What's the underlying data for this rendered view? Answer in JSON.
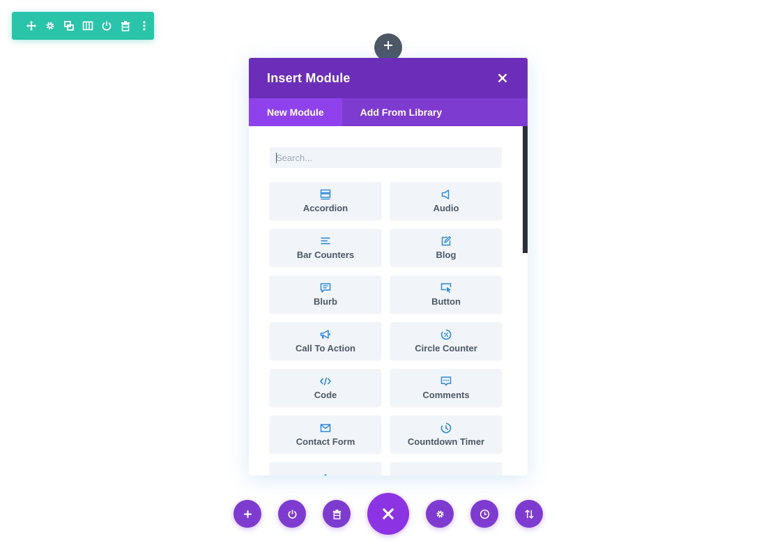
{
  "colors": {
    "row_toolbar": "#29c4a9",
    "modal_header": "#6c2eb9",
    "modal_tabs": "#7e3bd0",
    "modal_tab_active": "#8f42ec",
    "icon_blue": "#2b87da",
    "text": "#4c5866"
  },
  "row_toolbar": {
    "icons": [
      "move-icon",
      "settings-icon",
      "duplicate-icon",
      "columns-icon",
      "power-icon",
      "trash-icon",
      "more-icon"
    ]
  },
  "modal": {
    "title": "Insert Module",
    "tabs": [
      {
        "label": "New Module",
        "active": true
      },
      {
        "label": "Add From Library",
        "active": false
      }
    ],
    "search": {
      "placeholder": "Search...",
      "value": ""
    },
    "modules": [
      {
        "label": "Accordion",
        "icon": "accordion-icon"
      },
      {
        "label": "Audio",
        "icon": "audio-icon"
      },
      {
        "label": "Bar Counters",
        "icon": "bar-counters-icon"
      },
      {
        "label": "Blog",
        "icon": "blog-icon"
      },
      {
        "label": "Blurb",
        "icon": "blurb-icon"
      },
      {
        "label": "Button",
        "icon": "button-icon"
      },
      {
        "label": "Call To Action",
        "icon": "megaphone-icon"
      },
      {
        "label": "Circle Counter",
        "icon": "circle-counter-icon"
      },
      {
        "label": "Code",
        "icon": "code-icon"
      },
      {
        "label": "Comments",
        "icon": "comments-icon"
      },
      {
        "label": "Contact Form",
        "icon": "envelope-icon"
      },
      {
        "label": "Countdown Timer",
        "icon": "clock-icon"
      },
      {
        "label": "",
        "icon": "divider-icon"
      },
      {
        "label": "",
        "icon": "email-optin-icon"
      }
    ]
  },
  "bottom_bar": {
    "icons": [
      "add-icon",
      "power-icon",
      "trash-icon",
      "close-icon",
      "settings-icon",
      "history-icon",
      "sort-icon"
    ]
  }
}
